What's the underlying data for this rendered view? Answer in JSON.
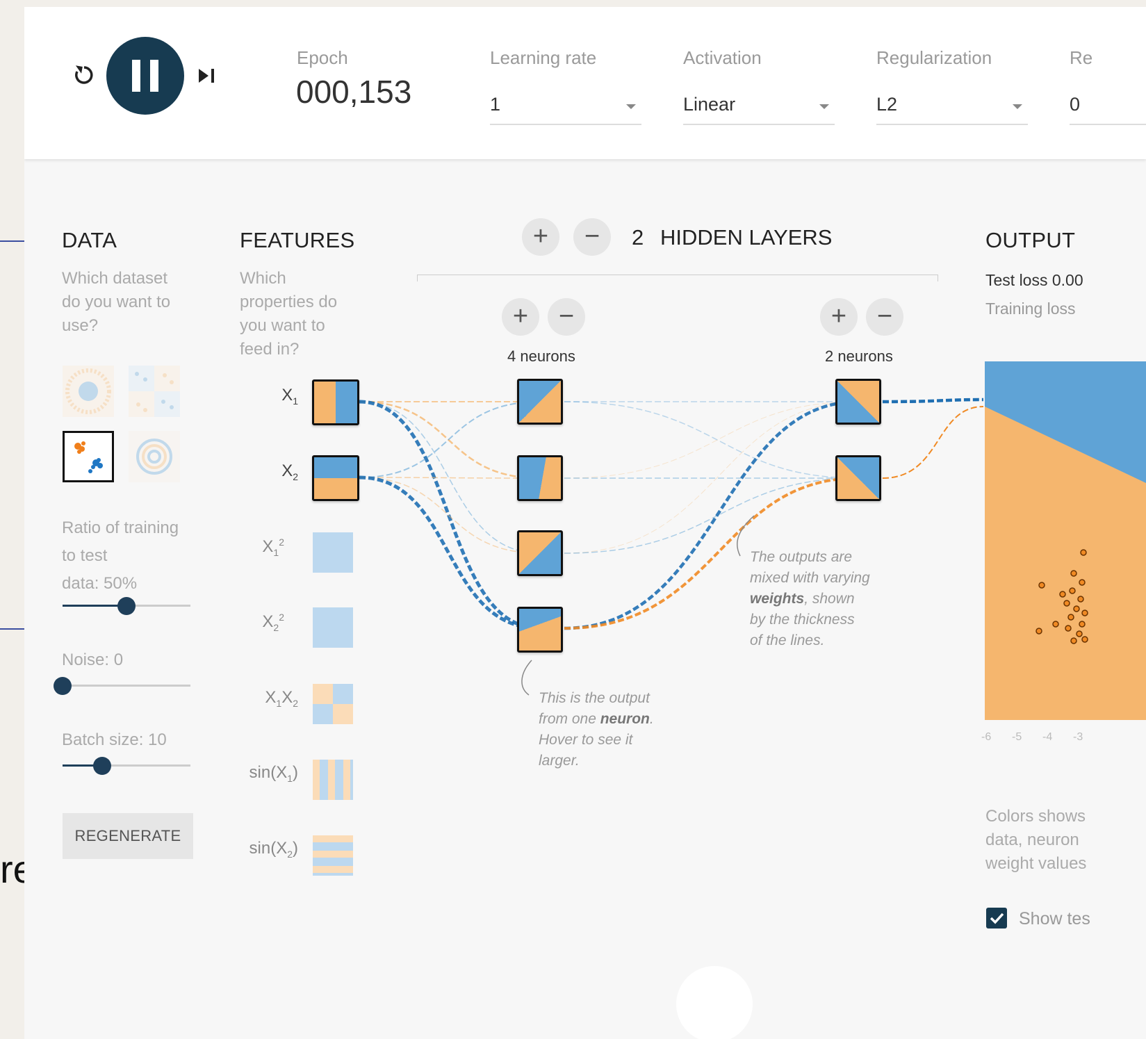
{
  "controls": {
    "reset_icon": "reset-icon",
    "pause_icon": "pause-icon",
    "step_icon": "step-forward-icon",
    "epoch_label": "Epoch",
    "epoch_value": "000,153",
    "learning_rate_label": "Learning rate",
    "learning_rate_value": "1",
    "activation_label": "Activation",
    "activation_value": "Linear",
    "regularization_label": "Regularization",
    "regularization_value": "L2",
    "reg_rate_label": "Re",
    "reg_rate_value": "0"
  },
  "data_panel": {
    "heading": "DATA",
    "question": [
      "Which dataset",
      "do you want to",
      "use?"
    ],
    "ratio_label": [
      "Ratio of training",
      "to test",
      "data:  50%"
    ],
    "ratio_value": 0.5,
    "noise_label": "Noise:  0",
    "noise_value": 0,
    "batch_label": "Batch size:  10",
    "batch_value": 0.31,
    "regenerate": "REGENERATE"
  },
  "features_panel": {
    "heading": "FEATURES",
    "question": [
      "Which",
      "properties do",
      "you want to",
      "feed in?"
    ],
    "features": [
      "X1",
      "X2",
      "X1²",
      "X2²",
      "X1X2",
      "sin(X1)",
      "sin(X2)"
    ]
  },
  "network": {
    "layer_count": "2",
    "layers_label": "HIDDEN LAYERS",
    "layer1_neurons": "4 neurons",
    "layer2_neurons": "2 neurons",
    "annotation1": [
      "This is the output",
      "from one neuron.",
      "Hover to see it",
      "larger."
    ],
    "annotation2": [
      "The outputs are",
      "mixed with varying",
      "weights, shown",
      "by the thickness",
      "of the lines."
    ]
  },
  "output_panel": {
    "heading": "OUTPUT",
    "test_loss": "Test loss 0.00",
    "training_loss": "Training loss",
    "axis_ticks": [
      "-6",
      "-5",
      "-4",
      "-3"
    ],
    "legend_text": [
      "Colors shows",
      "data, neuron",
      "weight values"
    ],
    "show_test_label": "Show tes"
  },
  "background": {
    "left_fragment": "re"
  },
  "colors": {
    "orange": "#f5b66e",
    "blue": "#5fa3d6",
    "dark": "#1a3e55"
  }
}
